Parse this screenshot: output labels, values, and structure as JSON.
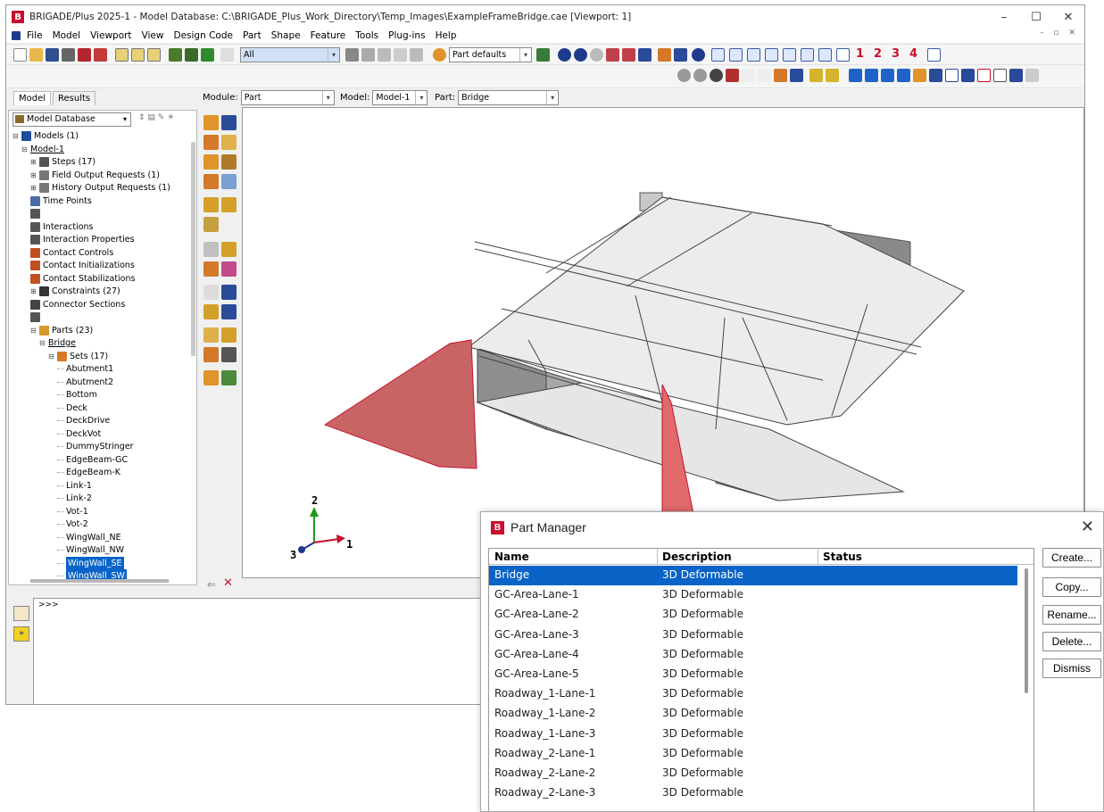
{
  "window": {
    "title": "BRIGADE/Plus 2025-1 - Model Database: C:\\BRIGADE_Plus_Work_Directory\\Temp_Images\\ExampleFrameBridge.cae [Viewport: 1]",
    "icon_letter": "B",
    "controls": [
      "–",
      "☐",
      "✕"
    ]
  },
  "menu": [
    "File",
    "Model",
    "Viewport",
    "View",
    "Design Code",
    "Part",
    "Shape",
    "Feature",
    "Tools",
    "Plug-ins",
    "Help"
  ],
  "toolbar": {
    "selection_filter": "All",
    "render_style": "Part defaults",
    "view_numbers": [
      "1",
      "2",
      "3",
      "4"
    ]
  },
  "tabs": [
    "Model",
    "Results"
  ],
  "context": {
    "module_label": "Module:",
    "module_value": "Part",
    "model_label": "Model:",
    "model_value": "Model-1",
    "part_label": "Part:",
    "part_value": "Bridge"
  },
  "tree": {
    "db_selector": "Model Database",
    "items": [
      {
        "label": "Models (1)",
        "indent": 0,
        "exp": "⊟",
        "icon": "#1e4d9a"
      },
      {
        "label": "Model-1",
        "indent": 1,
        "exp": "⊟",
        "icon": "",
        "underline": true
      },
      {
        "label": "Steps (17)",
        "indent": 2,
        "exp": "⊞",
        "icon": "#555"
      },
      {
        "label": "Field Output Requests (1)",
        "indent": 2,
        "exp": "⊞",
        "icon": "#777"
      },
      {
        "label": "History Output Requests (1)",
        "indent": 2,
        "exp": "⊞",
        "icon": "#777"
      },
      {
        "label": "Time Points",
        "indent": 2,
        "exp": "",
        "icon": "#4a6aa8"
      },
      {
        "label": "",
        "indent": 2,
        "exp": "",
        "icon": "#555"
      },
      {
        "label": "Interactions",
        "indent": 2,
        "exp": "",
        "icon": "#555"
      },
      {
        "label": "Interaction Properties",
        "indent": 2,
        "exp": "",
        "icon": "#555"
      },
      {
        "label": "Contact Controls",
        "indent": 2,
        "exp": "",
        "icon": "#c05020"
      },
      {
        "label": "Contact Initializations",
        "indent": 2,
        "exp": "",
        "icon": "#c05020"
      },
      {
        "label": "Contact Stabilizations",
        "indent": 2,
        "exp": "",
        "icon": "#c05020"
      },
      {
        "label": "Constraints (27)",
        "indent": 2,
        "exp": "⊞",
        "icon": "#333"
      },
      {
        "label": "Connector Sections",
        "indent": 2,
        "exp": "",
        "icon": "#444"
      },
      {
        "label": "",
        "indent": 2,
        "exp": "",
        "icon": "#555"
      },
      {
        "label": "Parts (23)",
        "indent": 2,
        "exp": "⊟",
        "icon": "#d49a2a"
      },
      {
        "label": "Bridge",
        "indent": 3,
        "exp": "⊟",
        "icon": "",
        "underline": true
      },
      {
        "label": "Sets (17)",
        "indent": 4,
        "exp": "⊟",
        "icon": "#d4792a"
      },
      {
        "label": "Abutment1",
        "indent": 5,
        "exp": "",
        "icon": ""
      },
      {
        "label": "Abutment2",
        "indent": 5,
        "exp": "",
        "icon": ""
      },
      {
        "label": "Bottom",
        "indent": 5,
        "exp": "",
        "icon": ""
      },
      {
        "label": "Deck",
        "indent": 5,
        "exp": "",
        "icon": ""
      },
      {
        "label": "DeckDrive",
        "indent": 5,
        "exp": "",
        "icon": ""
      },
      {
        "label": "DeckVot",
        "indent": 5,
        "exp": "",
        "icon": ""
      },
      {
        "label": "DummyStringer",
        "indent": 5,
        "exp": "",
        "icon": ""
      },
      {
        "label": "EdgeBeam-GC",
        "indent": 5,
        "exp": "",
        "icon": ""
      },
      {
        "label": "EdgeBeam-K",
        "indent": 5,
        "exp": "",
        "icon": ""
      },
      {
        "label": "Link-1",
        "indent": 5,
        "exp": "",
        "icon": ""
      },
      {
        "label": "Link-2",
        "indent": 5,
        "exp": "",
        "icon": ""
      },
      {
        "label": "Vot-1",
        "indent": 5,
        "exp": "",
        "icon": ""
      },
      {
        "label": "Vot-2",
        "indent": 5,
        "exp": "",
        "icon": ""
      },
      {
        "label": "WingWall_NE",
        "indent": 5,
        "exp": "",
        "icon": ""
      },
      {
        "label": "WingWall_NW",
        "indent": 5,
        "exp": "",
        "icon": ""
      },
      {
        "label": "WingWall_SE",
        "indent": 5,
        "exp": "",
        "icon": "",
        "selected": true
      },
      {
        "label": "WingWall_SW",
        "indent": 5,
        "exp": "",
        "icon": "",
        "selected": true
      }
    ]
  },
  "triad": {
    "x": "1",
    "y": "2",
    "z": "3"
  },
  "console": {
    "prompt": ">>>",
    "text": ""
  },
  "part_manager": {
    "title": "Part Manager",
    "icon_letter": "B",
    "close": "✕",
    "headers": [
      "Name",
      "Description",
      "Status"
    ],
    "rows": [
      {
        "name": "Bridge",
        "description": "3D Deformable",
        "status": "",
        "selected": true
      },
      {
        "name": "GC-Area-Lane-1",
        "description": "3D Deformable",
        "status": ""
      },
      {
        "name": "GC-Area-Lane-2",
        "description": "3D Deformable",
        "status": ""
      },
      {
        "name": "GC-Area-Lane-3",
        "description": "3D Deformable",
        "status": ""
      },
      {
        "name": "GC-Area-Lane-4",
        "description": "3D Deformable",
        "status": ""
      },
      {
        "name": "GC-Area-Lane-5",
        "description": "3D Deformable",
        "status": ""
      },
      {
        "name": "Roadway_1-Lane-1",
        "description": "3D Deformable",
        "status": ""
      },
      {
        "name": "Roadway_1-Lane-2",
        "description": "3D Deformable",
        "status": ""
      },
      {
        "name": "Roadway_1-Lane-3",
        "description": "3D Deformable",
        "status": ""
      },
      {
        "name": "Roadway_2-Lane-1",
        "description": "3D Deformable",
        "status": ""
      },
      {
        "name": "Roadway_2-Lane-2",
        "description": "3D Deformable",
        "status": ""
      },
      {
        "name": "Roadway_2-Lane-3",
        "description": "3D Deformable",
        "status": ""
      }
    ],
    "buttons": [
      "Create...",
      "Copy...",
      "Rename...",
      "Delete...",
      "Dismiss"
    ]
  },
  "colors": {
    "selection_blue": "#0a64c8",
    "wingwall_red": "#c86464",
    "deck_grey": "#ececec",
    "brand_red": "#c8102e"
  }
}
